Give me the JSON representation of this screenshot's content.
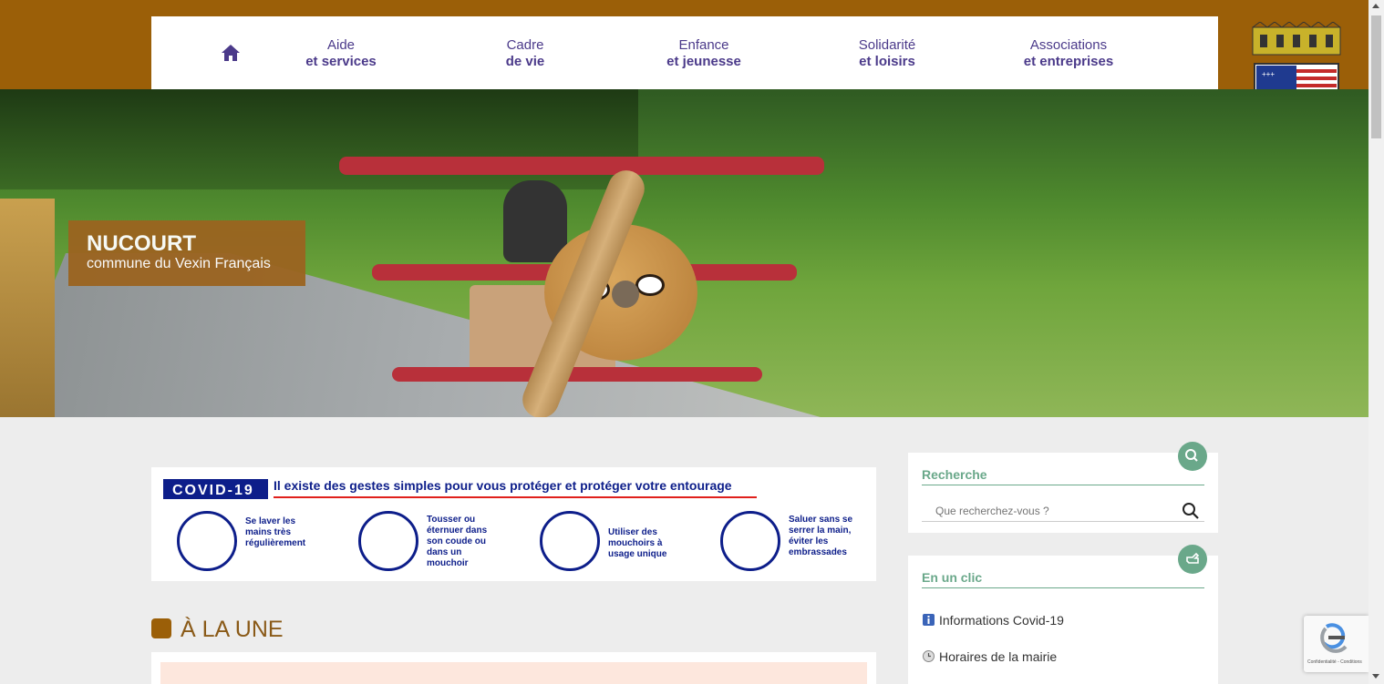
{
  "nav": {
    "items": [
      {
        "line1": "Aide",
        "line2": "et services"
      },
      {
        "line1": "Cadre",
        "line2": "de vie"
      },
      {
        "line1": "Enfance",
        "line2": "et jeunesse"
      },
      {
        "line1": "Solidarité",
        "line2": "et loisirs"
      },
      {
        "line1": "Associations",
        "line2": "et entreprises"
      }
    ]
  },
  "hero": {
    "title": "NUCOURT",
    "subtitle": "commune du Vexin Français"
  },
  "covid": {
    "badge": "COVID-19",
    "headline": "Il existe des gestes simples pour vous protéger et protéger votre entourage",
    "gestures": [
      "Se laver les mains très régulièrement",
      "Tousser ou éternuer dans son coude ou dans un mouchoir",
      "Utiliser des mouchoirs à usage unique",
      "Saluer sans se serrer la main, éviter les embrassades"
    ]
  },
  "news": {
    "heading": "À LA UNE"
  },
  "search": {
    "title": "Recherche",
    "placeholder": "Que recherchez-vous ?"
  },
  "quicklinks": {
    "title": "En un clic",
    "items": [
      {
        "label": "Informations Covid-19",
        "icon": "info-icon"
      },
      {
        "label": "Horaires de la mairie",
        "icon": "clock-icon"
      }
    ]
  },
  "recaptcha": {
    "text": "Confidentialité - Conditions"
  },
  "colors": {
    "brand": "#9b5f08",
    "nav_text": "#4b3a8a",
    "accent_green": "#6aa88a",
    "covid_blue": "#0d1e8a"
  }
}
